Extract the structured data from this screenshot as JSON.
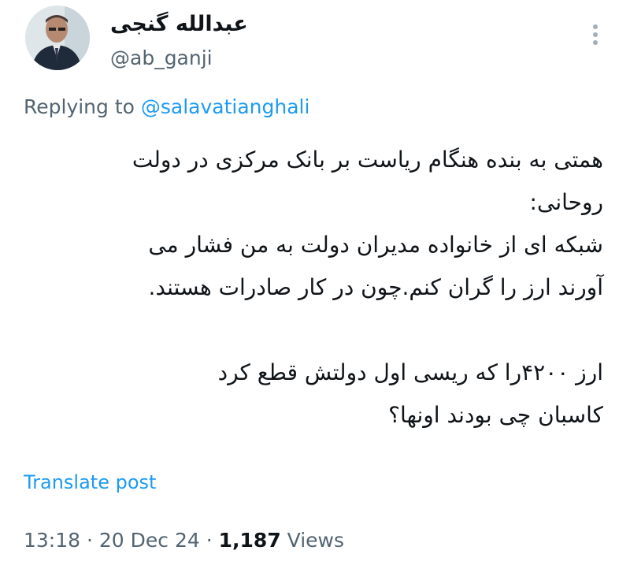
{
  "author": {
    "display_name": "عبدالله گنجی",
    "handle": "@ab_ganji",
    "avatar_icon": "profile-photo"
  },
  "more_icon": "more-vertical-icon",
  "reply": {
    "prefix": "Replying to ",
    "mention": "@salavatianghali"
  },
  "post": {
    "lines": [
      "همتی به بنده هنگام ریاست بر بانک مرکزی در دولت",
      "روحانی:",
      "شبکه ای از خانواده مدیران دولت به من فشار می",
      "آورند ارز را گران کنم.چون در کار صادرات هستند.",
      "",
      "ارز ۴۲۰۰را که ریسی اول دولتش قطع کرد",
      "کاسبان چی بودند اونها؟"
    ]
  },
  "translate_label": "Translate post",
  "meta": {
    "time": "13:18",
    "separator": " · ",
    "date": "20 Dec 24",
    "views_count": "1,187",
    "views_label": " Views"
  },
  "colors": {
    "link": "#1d9bf0",
    "secondary_text": "#536471",
    "primary_text": "#0f1419"
  }
}
